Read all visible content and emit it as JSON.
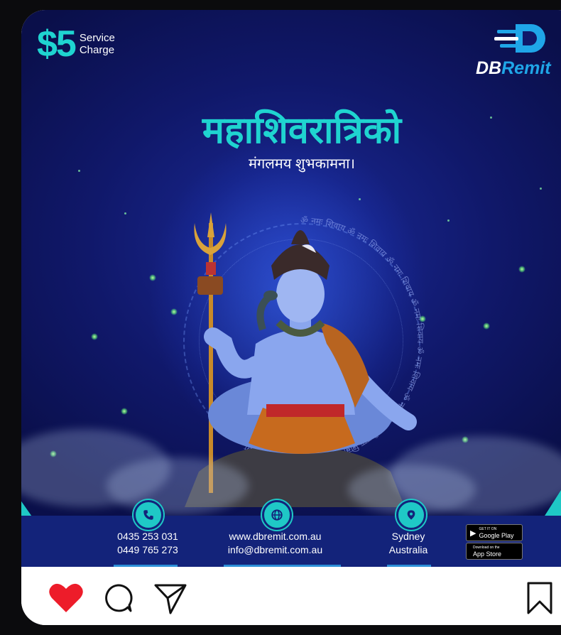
{
  "post": {
    "price_symbol": "$",
    "price_amount": "5",
    "price_label_line1": "Service",
    "price_label_line2": "Charge",
    "brand_part1": "DB",
    "brand_part2": "Remit",
    "title": "महाशिवरात्रिको",
    "subtitle": "मंगलमय शुभकामना।",
    "mantra": "ॐ नमः शिवाय",
    "phone1": "0435 253 031",
    "phone2": "0449 765 273",
    "website": "www.dbremit.com.au",
    "email": "info@dbremit.com.au",
    "city": "Sydney",
    "country": "Australia",
    "google_small": "GET IT ON",
    "google_big": "Google Play",
    "apple_small": "Download on the",
    "apple_big": "App Store"
  },
  "actions": {
    "like_icon": "heart-icon",
    "comment_icon": "comment-icon",
    "share_icon": "share-icon",
    "save_icon": "bookmark-icon"
  },
  "colors": {
    "accent": "#1fd4d0",
    "background": "#10186a",
    "footer": "#13237a",
    "like": "#ed1c2a",
    "brand_blue": "#1fa6e8"
  }
}
